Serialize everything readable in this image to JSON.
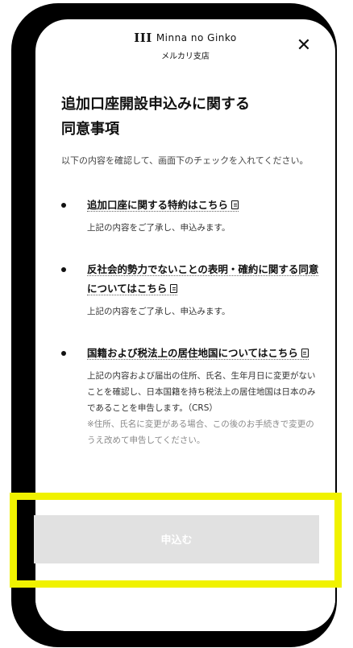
{
  "header": {
    "logo_mark": "III",
    "logo_text": "Minna no Ginko",
    "branch": "メルカリ支店",
    "close_symbol": "✕"
  },
  "main": {
    "title_line1": "追加口座開設申込みに関する",
    "title_line2": "同意事項",
    "intro": "以下の内容を確認して、画面下のチェックを入れてください。",
    "items": [
      {
        "link": "追加口座に関する特約はこちら",
        "sub": "上記の内容をご了承し、申込みます。"
      },
      {
        "link": "反社会的勢力でないことの表明・確約に関する同意についてはこちら",
        "sub": "上記の内容をご了承し、申込みます。"
      },
      {
        "link": "国籍および税法上の居住地国についてはこちら",
        "sub": "上記の内容および届出の住所、氏名、生年月日に変更がないことを確認し、日本国籍を持ち税法上の居住地国は日本のみであることを申告します。（CRS）",
        "note": "※住所、氏名に変更がある場合、この後のお手続きで変更のうえ改めて申告してください。"
      }
    ]
  },
  "footer": {
    "submit_label": "申込む"
  },
  "colors": {
    "highlight": "#f0f200",
    "button_disabled": "#e1e1e1"
  }
}
